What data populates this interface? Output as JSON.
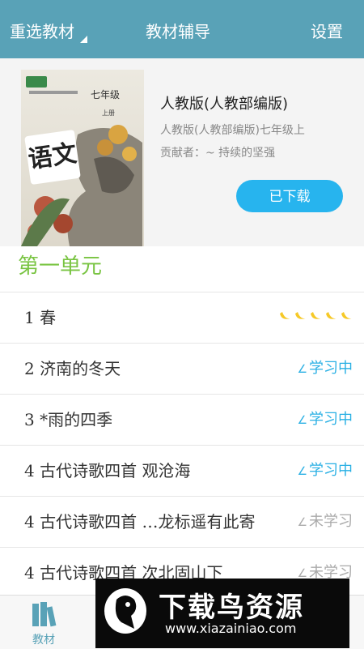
{
  "header": {
    "left_label": "重选教材",
    "title": "教材辅导",
    "right_label": "设置"
  },
  "book": {
    "cover": {
      "grade": "七年级",
      "volume": "上册",
      "subject": "语文"
    },
    "title": "人教版(人教部编版)",
    "subtitle": "人教版(人教部编版)七年级上",
    "contributor": "贡献者：~ 持续的坚强",
    "download_label": "已下载"
  },
  "unit": {
    "title": "第一单元"
  },
  "lessons": [
    {
      "title": "1 春",
      "status": "",
      "rating": 5
    },
    {
      "title": "2 济南的冬天",
      "status": "学习中",
      "state": "learning"
    },
    {
      "title": "3 *雨的四季",
      "status": "学习中",
      "state": "learning"
    },
    {
      "title": "4 古代诗歌四首 观沧海",
      "status": "学习中",
      "state": "learning"
    },
    {
      "title": "4 古代诗歌四首 …龙标遥有此寄",
      "status": "未学习",
      "state": "notyet"
    },
    {
      "title": "4 古代诗歌四首 次北固山下",
      "status": "未学习",
      "state": "notyet"
    }
  ],
  "bottom_nav": {
    "tab_textbook": "教材"
  },
  "watermark": {
    "main": "下载鸟资源",
    "url": "www.xiazainiao.com"
  },
  "colors": {
    "header_bg": "#59a2b7",
    "accent": "#27b4ee",
    "unit_title": "#79c442",
    "learning": "#2ab0e4",
    "banana": "#f6c927"
  }
}
